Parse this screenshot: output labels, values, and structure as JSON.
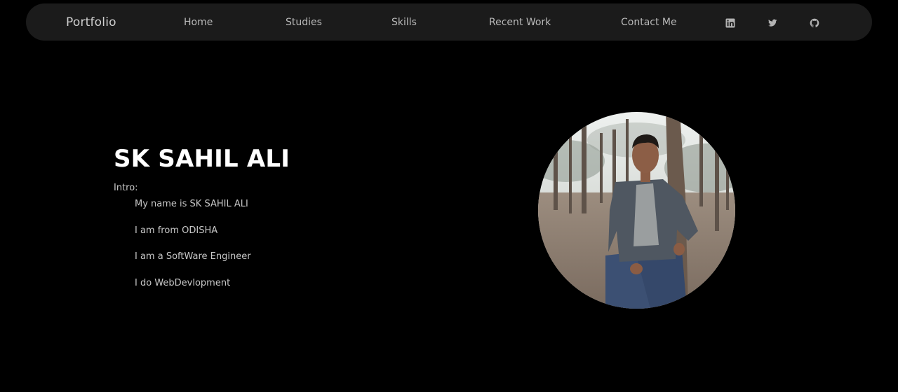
{
  "nav": {
    "brand": "Portfolio",
    "links": [
      "Home",
      "Studies",
      "Skills",
      "Recent Work",
      "Contact Me"
    ],
    "social_icons": [
      "linkedin-icon",
      "twitter-icon",
      "github-icon"
    ]
  },
  "hero": {
    "name": "SK SAHIL ALI",
    "intro_label": "Intro:",
    "intro_items": [
      "My name is SK SAHIL ALI",
      "I am from ODISHA",
      "I am a SoftWare Engineer",
      "I do WebDevlopment"
    ]
  },
  "colors": {
    "background": "#000000",
    "navbar": "#1b1b1b",
    "nav_text": "#b9b9b9",
    "heading": "#ffffff",
    "body_text": "#c8c8c8"
  }
}
